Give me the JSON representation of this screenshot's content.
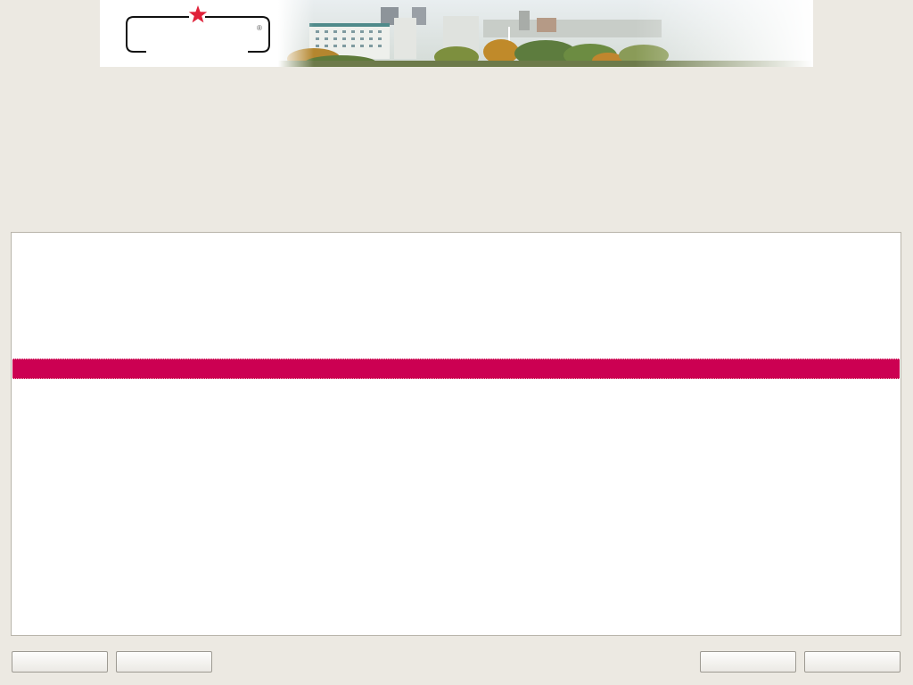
{
  "banner": {
    "logo_mark": "®",
    "logo_icon": "red-star-icon",
    "photo_subject": "city-panorama"
  },
  "colors": {
    "background": "#ece9e2",
    "panel": "#ffffff",
    "highlight": "#cc0052",
    "star": "#e0223a"
  },
  "buttons": [
    {
      "label": ""
    },
    {
      "label": ""
    },
    {
      "label": ""
    },
    {
      "label": ""
    }
  ]
}
